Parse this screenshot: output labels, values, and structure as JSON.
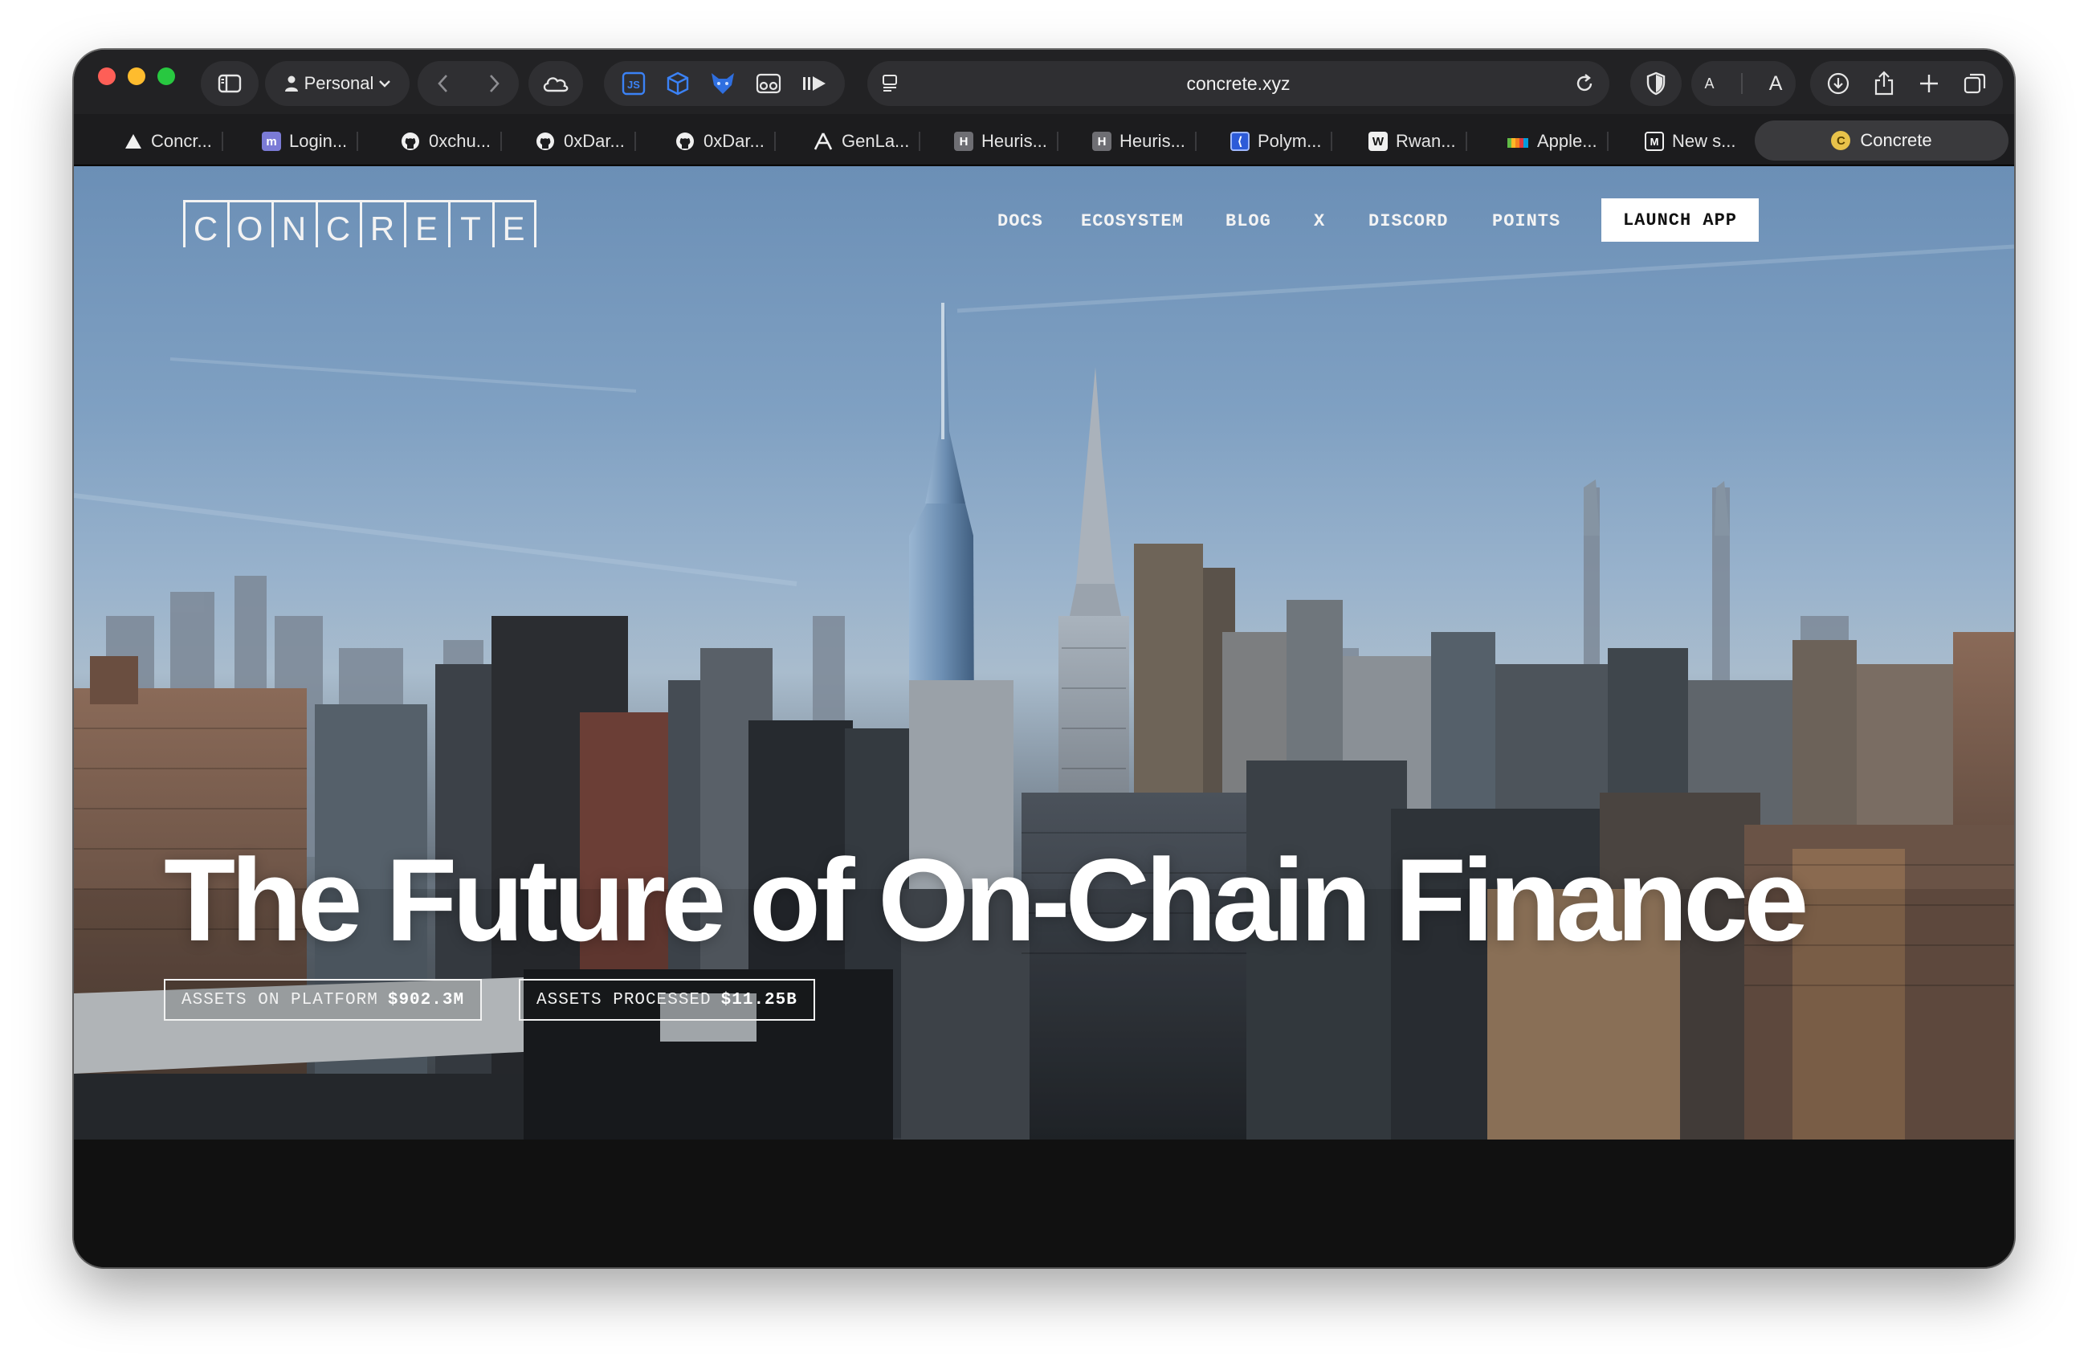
{
  "browser": {
    "profile_label": "Personal",
    "address": "concrete.xyz"
  },
  "tabs": [
    {
      "title": "Concr...",
      "icon": "triangle-icon"
    },
    {
      "title": "Login...",
      "icon": "m-badge-icon"
    },
    {
      "title": "0xchu...",
      "icon": "github-icon"
    },
    {
      "title": "0xDar...",
      "icon": "github-icon"
    },
    {
      "title": "0xDar...",
      "icon": "github-icon"
    },
    {
      "title": "GenLa...",
      "icon": "genlayer-icon"
    },
    {
      "title": "Heuris...",
      "icon": "h-badge-icon"
    },
    {
      "title": "Heuris...",
      "icon": "h-badge-icon"
    },
    {
      "title": "Polym...",
      "icon": "polymarket-icon"
    },
    {
      "title": "Rwan...",
      "icon": "w-badge-icon"
    },
    {
      "title": "Apple...",
      "icon": "apple-color-icon"
    },
    {
      "title": "New s...",
      "icon": "m-outline-icon"
    }
  ],
  "active_tab": {
    "title": "Concrete",
    "icon": "c-coin-icon",
    "icon_letter": "C"
  },
  "site": {
    "logo_letters": [
      "C",
      "O",
      "N",
      "C",
      "R",
      "E",
      "T",
      "E"
    ],
    "nav": [
      "DOCS",
      "ECOSYSTEM",
      "BLOG",
      "X",
      "DISCORD",
      "POINTS"
    ],
    "launch_label": "LAUNCH APP",
    "headline": "The Future of On-Chain Finance",
    "stats": [
      {
        "label": "ASSETS ON PLATFORM",
        "value": "$902.3M"
      },
      {
        "label": "ASSETS PROCESSED",
        "value": "$11.25B"
      }
    ]
  },
  "colors": {
    "window_bg": "#111111",
    "toolbar_bg": "#222224",
    "tab_bar_bg": "#1c1c1e",
    "traffic_red": "#fe5f57",
    "traffic_yellow": "#febc2e",
    "traffic_green": "#28c840",
    "extension_blue": "#3b82f6",
    "launch_bg": "#ffffff"
  }
}
